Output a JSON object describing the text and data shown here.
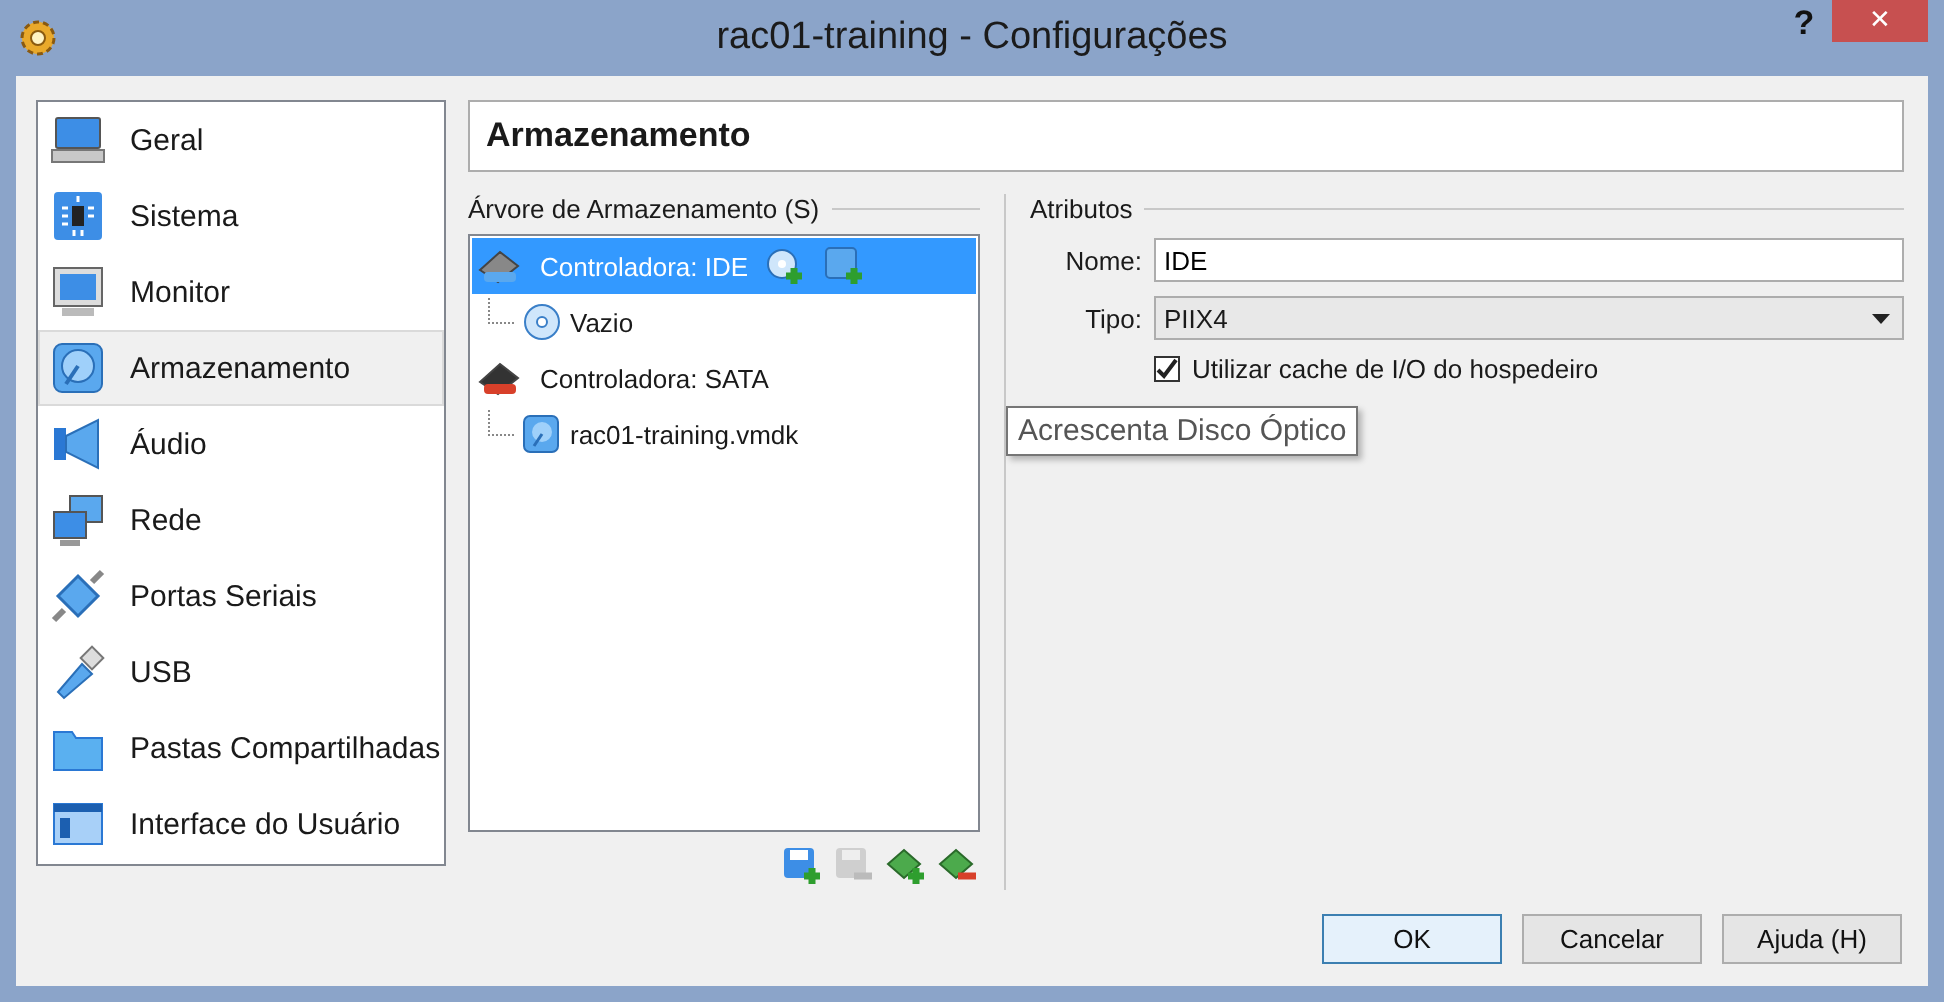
{
  "window": {
    "title": "rac01-training - Configurações",
    "help": "?",
    "close": "✕"
  },
  "sidebar": {
    "items": [
      {
        "label": "Geral",
        "selected": false
      },
      {
        "label": "Sistema",
        "selected": false
      },
      {
        "label": "Monitor",
        "selected": false
      },
      {
        "label": "Armazenamento",
        "selected": true
      },
      {
        "label": "Áudio",
        "selected": false
      },
      {
        "label": "Rede",
        "selected": false
      },
      {
        "label": "Portas Seriais",
        "selected": false
      },
      {
        "label": "USB",
        "selected": false
      },
      {
        "label": "Pastas Compartilhadas",
        "selected": false
      },
      {
        "label": "Interface do Usuário",
        "selected": false
      }
    ]
  },
  "page_title": "Armazenamento",
  "storage_tree": {
    "label": "Árvore de Armazenamento (S)",
    "controllers": [
      {
        "label": "Controladora: IDE",
        "kind": "ide",
        "selected": true,
        "children": [
          {
            "label": "Vazio",
            "kind": "optical",
            "selected": false
          }
        ]
      },
      {
        "label": "Controladora: SATA",
        "kind": "sata",
        "selected": false,
        "children": [
          {
            "label": "rac01-training.vmdk",
            "kind": "disk",
            "selected": false
          }
        ]
      }
    ]
  },
  "attributes": {
    "label": "Atributos",
    "name_label": "Nome:",
    "name_value": "IDE",
    "type_label": "Tipo:",
    "type_value": "PIIX4",
    "cache_label": "Utilizar cache de I/O do hospedeiro",
    "cache_checked": true
  },
  "tooltip": "Acrescenta Disco Óptico",
  "buttons": [
    {
      "label": "OK",
      "default": true
    },
    {
      "label": "Cancelar",
      "default": false
    },
    {
      "label": "Ajuda (H)",
      "default": false
    }
  ]
}
